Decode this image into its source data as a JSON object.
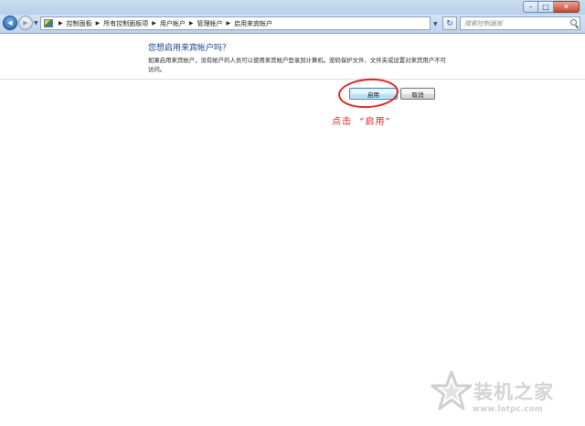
{
  "window": {
    "caption_buttons": {
      "minimize": "–",
      "maximize": "□",
      "close": "✕"
    }
  },
  "navbar": {
    "back_glyph": "◀",
    "forward_glyph": "▶",
    "dropdown_glyph": "▼",
    "refresh_glyph": "↻",
    "breadcrumbs": [
      "控制面板",
      "所有控制面板项",
      "用户帐户",
      "管理帐户",
      "启用来宾帐户"
    ],
    "search_placeholder": "搜索控制面板"
  },
  "main": {
    "heading": "您想启用来宾帐户吗？",
    "description": "如果启用来宾帐户，没有帐户的人员可以使用来宾帐户登录到计算机。密码保护文件、文件夹或设置对来宾用户不可访问。",
    "enable_label": "启用",
    "cancel_label": "取消"
  },
  "annotation": {
    "text": "点击  “启用”",
    "color": "#e02424"
  },
  "watermark": {
    "brand": "装机之家",
    "url": "www.lotpc.com"
  },
  "icons": {
    "control_panel": "control-panel-icon",
    "search": "search-icon",
    "back": "back-arrow-icon",
    "forward": "forward-arrow-icon",
    "refresh": "refresh-icon",
    "watermark_star": "star-logo-icon"
  }
}
